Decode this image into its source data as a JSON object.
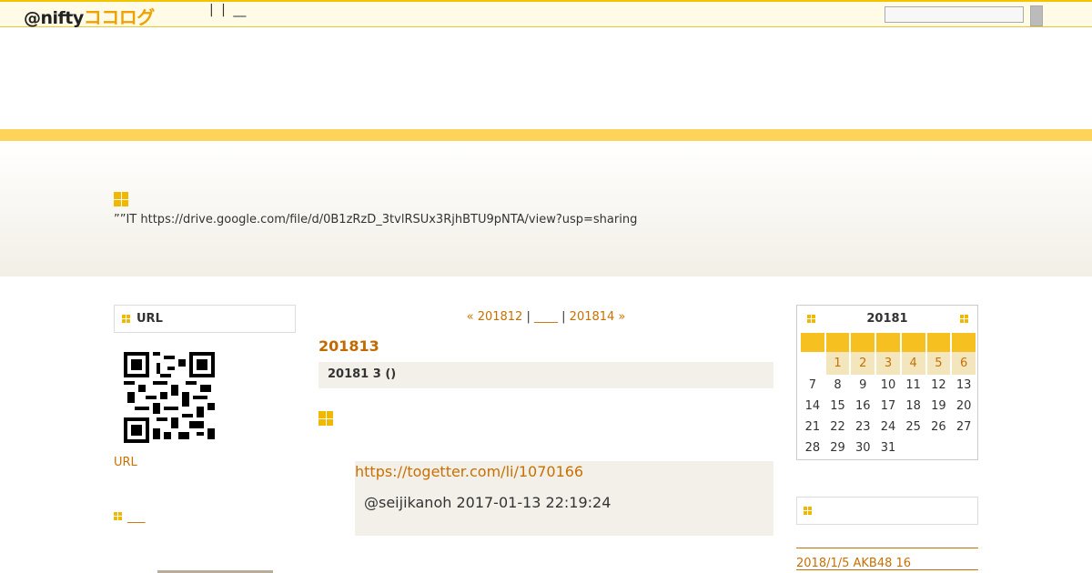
{
  "header": {
    "logo_prefix": "@nifty",
    "logo_brand": "ココログ",
    "links": [
      "|",
      "|",
      "__"
    ]
  },
  "hero": {
    "text": "””IT  https://drive.google.com/file/d/0B1zRzD_3tvlRSUx3RjhBTU9pNTA/view?usp=sharing"
  },
  "left": {
    "url_box_title": "URL",
    "url_link": "URL",
    "section2_link": "___"
  },
  "main": {
    "prev": "« 201812",
    "sep1": "|",
    "main_link": "____",
    "sep2": "|",
    "next": "201814 »",
    "month_title": "201813",
    "date_header": "20181 3 ()",
    "quote_link": "https://togetter.com/li/1070166",
    "quote_attrib": "@seijikanoh 2017-01-13 22:19:24"
  },
  "calendar": {
    "title": "20181",
    "weeks": [
      [
        "",
        "1",
        "2",
        "3",
        "4",
        "5",
        "6"
      ],
      [
        "7",
        "8",
        "9",
        "10",
        "11",
        "12",
        "13"
      ],
      [
        "14",
        "15",
        "16",
        "17",
        "18",
        "19",
        "20"
      ],
      [
        "21",
        "22",
        "23",
        "24",
        "25",
        "26",
        "27"
      ],
      [
        "28",
        "29",
        "30",
        "31",
        "",
        "",
        ""
      ]
    ],
    "linked_days": [
      "1",
      "2",
      "3",
      "4",
      "5",
      "6"
    ]
  },
  "right": {
    "recent_link": "2018/1/5 AKB48 16"
  },
  "colors": {
    "accent": "#f0b800",
    "link": "#c87000",
    "band": "#fdd35a"
  }
}
